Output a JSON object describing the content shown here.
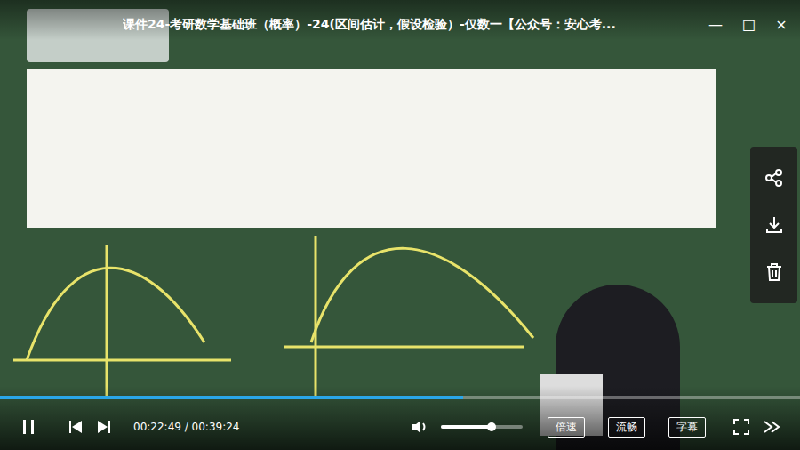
{
  "window": {
    "title": "课件24-考研数学基础班（概率）-24(区间估计，假设检验）-仅数一【公众号：安心考...",
    "buttons": [
      "—",
      "□",
      "×"
    ]
  },
  "player": {
    "progress": {
      "level": 0.579
    },
    "time": "00:22:49 / 00:39:24",
    "volume": {
      "level": 0.62
    },
    "buttons": [
      "倍速",
      "流畅",
      "字幕"
    ]
  }
}
